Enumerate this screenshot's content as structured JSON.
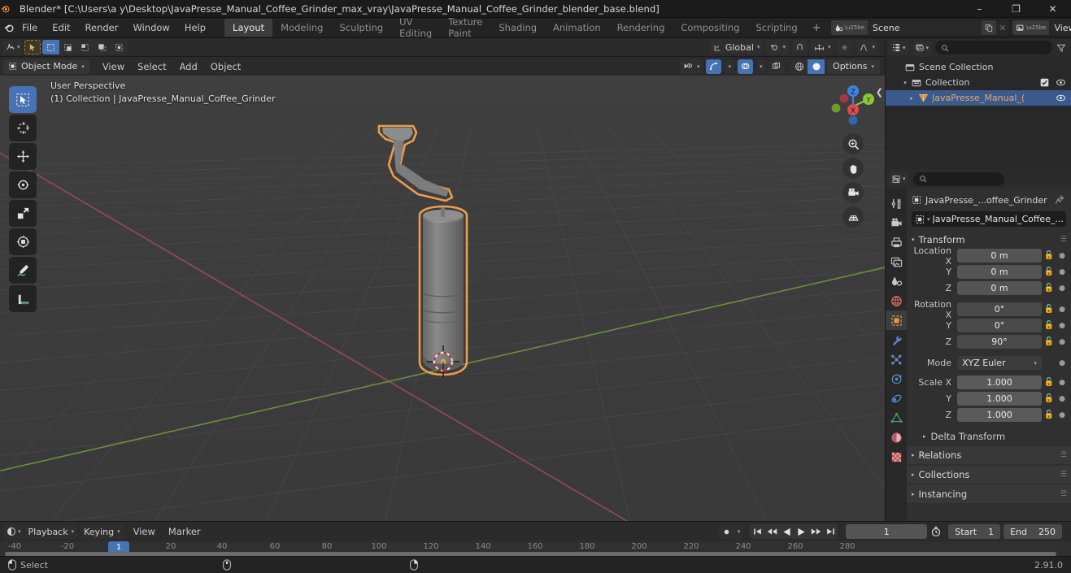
{
  "titlebar": {
    "app_icon": "blender-logo-icon",
    "title": "Blender* [C:\\Users\\a y\\Desktop\\JavaPresse_Manual_Coffee_Grinder_max_vray\\JavaPresse_Manual_Coffee_Grinder_blender_base.blend]",
    "minimize": "–",
    "maximize": "❐",
    "close": "✕"
  },
  "topbar": {
    "menus": [
      "File",
      "Edit",
      "Render",
      "Window",
      "Help"
    ],
    "workspaces": [
      {
        "label": "Layout",
        "active": true
      },
      {
        "label": "Modeling",
        "active": false
      },
      {
        "label": "Sculpting",
        "active": false
      },
      {
        "label": "UV Editing",
        "active": false
      },
      {
        "label": "Texture Paint",
        "active": false
      },
      {
        "label": "Shading",
        "active": false
      },
      {
        "label": "Animation",
        "active": false
      },
      {
        "label": "Rendering",
        "active": false
      },
      {
        "label": "Compositing",
        "active": false
      },
      {
        "label": "Scripting",
        "active": false
      }
    ],
    "add_workspace": "+",
    "scene": {
      "name": "Scene",
      "new_btn": "new-scene-icon",
      "unlink_btn": "✕"
    },
    "view_layer": {
      "name": "View Layer",
      "new_btn": "new-viewlayer-icon",
      "unlink_btn": "✕"
    }
  },
  "viewport": {
    "header": {
      "editor_type": "editor-type-icon",
      "cursor_tool": "select-tool-icon",
      "select_modes": [
        "set",
        "extend",
        "subtract",
        "invert",
        "intersect"
      ],
      "transform_orientation": "Global",
      "pivot_point": "pivot-icon",
      "snapping": "magnet-icon",
      "snap_to": "snap-increment-icon",
      "proportional_edit": "proportional-icon",
      "falloff": "falloff-curve-icon",
      "options_label": "Options",
      "gizmo_toggle": "gizmo-icon",
      "overlays_toggle": "overlays-icon",
      "xray_toggle": "xray-icon",
      "shading_modes": [
        "wireframe",
        "solid",
        "material-preview",
        "rendered"
      ],
      "active_shading": "solid"
    },
    "sub": {
      "mode": "Object Mode",
      "menus": [
        "View",
        "Select",
        "Add",
        "Object"
      ]
    },
    "overlay_text": {
      "line1": "User Perspective",
      "line2": "(1) Collection | JavaPresse_Manual_Coffee_Grinder"
    },
    "toolbar": [
      {
        "name": "tweak-select-box-tool",
        "active": true
      },
      {
        "name": "cursor-tool",
        "active": false
      },
      {
        "name": "move-tool",
        "active": false
      },
      {
        "name": "rotate-tool",
        "active": false
      },
      {
        "name": "scale-tool",
        "active": false
      },
      {
        "name": "transform-tool",
        "active": false
      },
      {
        "name": "annotate-tool",
        "active": false
      },
      {
        "name": "measure-tool",
        "active": false
      }
    ],
    "nav_gizmo": {
      "axes": [
        "X",
        "Y",
        "Z"
      ],
      "x_color": "#e04a50",
      "y_color": "#8ec736",
      "z_color": "#3e84e0"
    },
    "nav_buttons": [
      "zoom-icon",
      "pan-hand-icon",
      "camera-view-icon",
      "toggle-ortho-grid-icon"
    ],
    "object": {
      "name": "JavaPresse_Manual_Coffee_Grinder",
      "outline_color": "#ed9e4e",
      "body_color": "#7d7d7d"
    }
  },
  "outliner": {
    "display_mode": "outliner-display-mode-icon",
    "filter_id": "filter-id-icon",
    "search_placeholder": "",
    "filter_icon": "filter-funnel-icon",
    "rows": [
      {
        "label": "Scene Collection",
        "icon": "scene-collection-icon",
        "indent": 0,
        "selected": false,
        "expand": "",
        "checkbox": false,
        "eye": false
      },
      {
        "label": "Collection",
        "icon": "collection-icon",
        "indent": 1,
        "selected": false,
        "expand": "▾",
        "checkbox": true,
        "eye": true
      },
      {
        "label": "JavaPresse_Manual_(",
        "icon": "mesh-object-icon",
        "indent": 2,
        "selected": true,
        "expand": "▸",
        "checkbox": false,
        "eye": true
      }
    ]
  },
  "properties": {
    "editor_icon": "properties-editor-icon",
    "search_placeholder": "",
    "tabs": [
      {
        "name": "tool-tab",
        "active": false
      },
      {
        "name": "render-tab",
        "active": false
      },
      {
        "name": "output-tab",
        "active": false
      },
      {
        "name": "view-layer-tab",
        "active": false
      },
      {
        "name": "scene-tab",
        "active": false
      },
      {
        "name": "world-tab",
        "active": false
      },
      {
        "name": "object-tab",
        "active": true
      },
      {
        "name": "modifier-tab",
        "active": false
      },
      {
        "name": "particles-tab",
        "active": false
      },
      {
        "name": "physics-tab",
        "active": false
      },
      {
        "name": "constraints-tab",
        "active": false
      },
      {
        "name": "object-data-tab",
        "active": false
      },
      {
        "name": "material-tab",
        "active": false
      },
      {
        "name": "texture-tab",
        "active": false
      }
    ],
    "breadcrumb": "JavaPresse_...offee_Grinder",
    "pin_icon": "pin-icon",
    "object_field": "JavaPresse_Manual_Coffee_...",
    "transform": {
      "title": "Transform",
      "location": {
        "label": "Location X",
        "x": "0 m",
        "y": "0 m",
        "z": "0 m",
        "y_label": "Y",
        "z_label": "Z"
      },
      "rotation": {
        "label": "Rotation X",
        "x": "0°",
        "y": "0°",
        "z": "90°",
        "y_label": "Y",
        "z_label": "Z"
      },
      "mode": {
        "label": "Mode",
        "value": "XYZ Euler"
      },
      "scale": {
        "label": "Scale X",
        "x": "1.000",
        "y": "1.000",
        "z": "1.000",
        "y_label": "Y",
        "z_label": "Z"
      },
      "delta_transform": "Delta Transform"
    },
    "panels": [
      "Relations",
      "Collections",
      "Instancing"
    ]
  },
  "timeline": {
    "editor_icon": "timeline-editor-icon",
    "menus": [
      "Playback",
      "Keying",
      "View",
      "Marker"
    ],
    "record_icon": "record-icon",
    "transport": [
      "jump-start",
      "prev-keyframe",
      "play-reverse",
      "play",
      "next-keyframe",
      "jump-end"
    ],
    "current_frame": "1",
    "timer_icon": "auto-key-timer-icon",
    "start_label": "Start",
    "start_value": "1",
    "end_label": "End",
    "end_value": "250",
    "ruler_ticks": [
      "-40",
      "-20",
      "20",
      "40",
      "60",
      "80",
      "100",
      "120",
      "140",
      "160",
      "180",
      "200",
      "220",
      "240",
      "260",
      "280"
    ],
    "playhead": "1"
  },
  "statusbar": {
    "mouse_left_icon": "mouse-left-icon",
    "left_label": "Select",
    "mouse_middle_icon": "mouse-middle-icon",
    "middle_label": "",
    "mouse_right_icon": "mouse-right-icon",
    "right_label": "",
    "version": "2.91.0"
  }
}
